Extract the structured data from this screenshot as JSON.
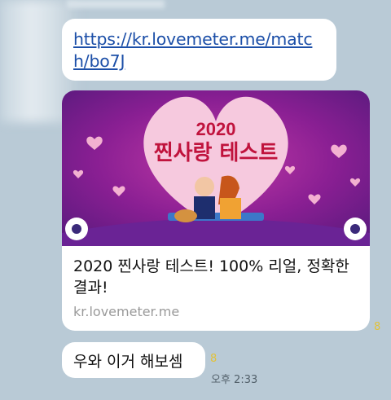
{
  "messages": {
    "link": {
      "url_text": "https://kr.lovemeter.me/match/bo7J"
    },
    "preview": {
      "banner_year": "2020",
      "banner_title": "찐사랑 테스트",
      "title": "2020 찐사랑 테스트! 100% 리얼, 정확한 결과!",
      "domain": "kr.lovemeter.me",
      "unread_count": "8"
    },
    "reply": {
      "text": "우와 이거 해보셈",
      "unread_count": "8",
      "time": "오후 2:33"
    }
  },
  "colors": {
    "background": "#b9cad6",
    "bubble": "#ffffff",
    "link": "#1c4fa8",
    "unread": "#e2c23a",
    "banner_purple": "#8a1f93",
    "banner_title_red": "#c0133d"
  }
}
